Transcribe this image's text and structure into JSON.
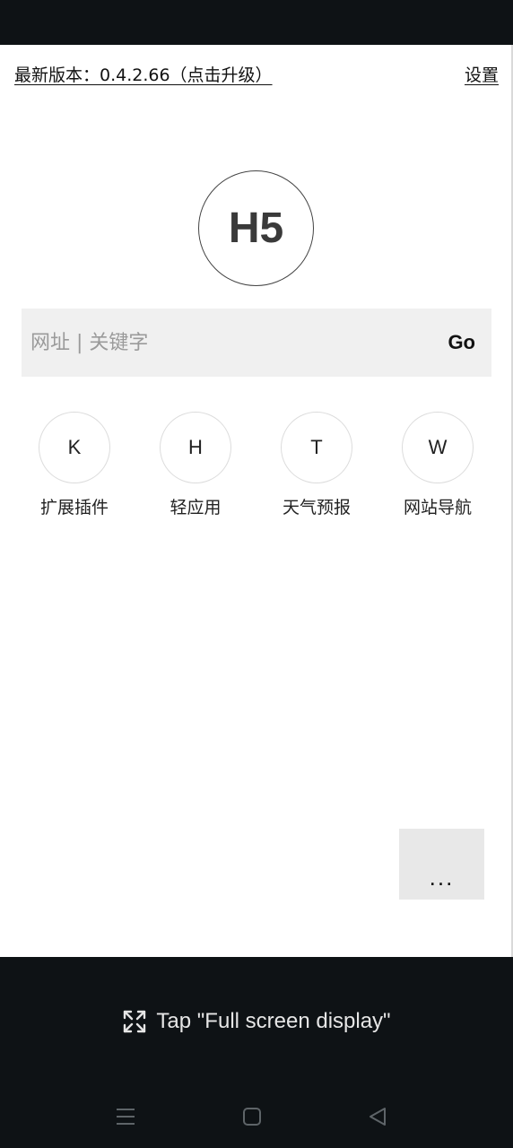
{
  "header": {
    "version_text": "最新版本：0.4.2.66（点击升级）",
    "settings_label": "设置"
  },
  "logo": {
    "text": "H5"
  },
  "search": {
    "placeholder": "网址 | 关键字",
    "value": "",
    "go_label": "Go"
  },
  "shortcuts": [
    {
      "letter": "K",
      "label": "扩展插件"
    },
    {
      "letter": "H",
      "label": "轻应用"
    },
    {
      "letter": "T",
      "label": "天气预报"
    },
    {
      "letter": "W",
      "label": "网站导航"
    }
  ],
  "more_button": {
    "label": "..."
  },
  "system": {
    "fullscreen_hint": "Tap \"Full screen display\"",
    "nav_icons": [
      "menu-icon",
      "home-icon",
      "back-icon"
    ]
  },
  "colors": {
    "system_bar": "#0e1215",
    "search_bg": "#f0f0f0",
    "more_bg": "#e8e8e8"
  }
}
